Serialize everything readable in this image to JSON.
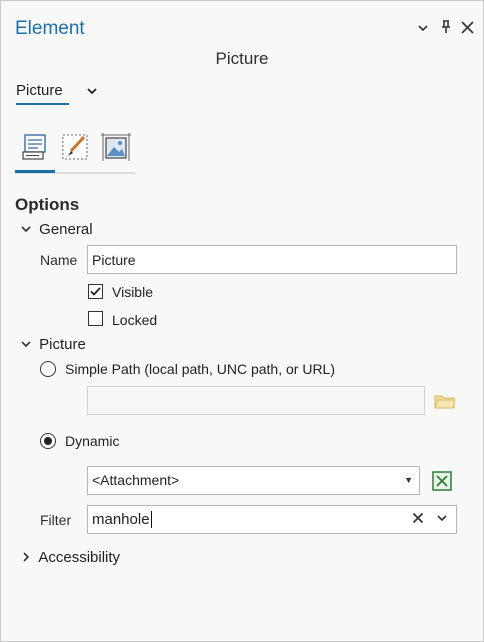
{
  "window": {
    "title": "Element",
    "pin_glyph": "📌",
    "close_glyph": "✕",
    "menu_glyph": "⌄"
  },
  "header": {
    "subtitle": "Picture",
    "element_selector": "Picture"
  },
  "tabs": [
    {
      "icon": "options-list-icon",
      "active": true
    },
    {
      "icon": "symbol-brush-icon",
      "active": false
    },
    {
      "icon": "display-picture-icon",
      "active": false
    }
  ],
  "options": {
    "heading": "Options",
    "general": {
      "label": "General",
      "name_label": "Name",
      "name_value": "Picture",
      "visible_label": "Visible",
      "visible_checked": true,
      "locked_label": "Locked",
      "locked_checked": false
    },
    "picture": {
      "label": "Picture",
      "simple_path_label": "Simple Path (local path, UNC path, or URL)",
      "simple_path_selected": false,
      "path_value": "",
      "dynamic_label": "Dynamic",
      "dynamic_selected": true,
      "attachment_value": "<Attachment>",
      "filter_label": "Filter",
      "filter_value": "manhole"
    },
    "accessibility": {
      "label": "Accessibility"
    }
  },
  "colors": {
    "accent": "#1e6fa8",
    "excel_green": "#2e7d32",
    "folder_yellow": "#e8c873"
  }
}
